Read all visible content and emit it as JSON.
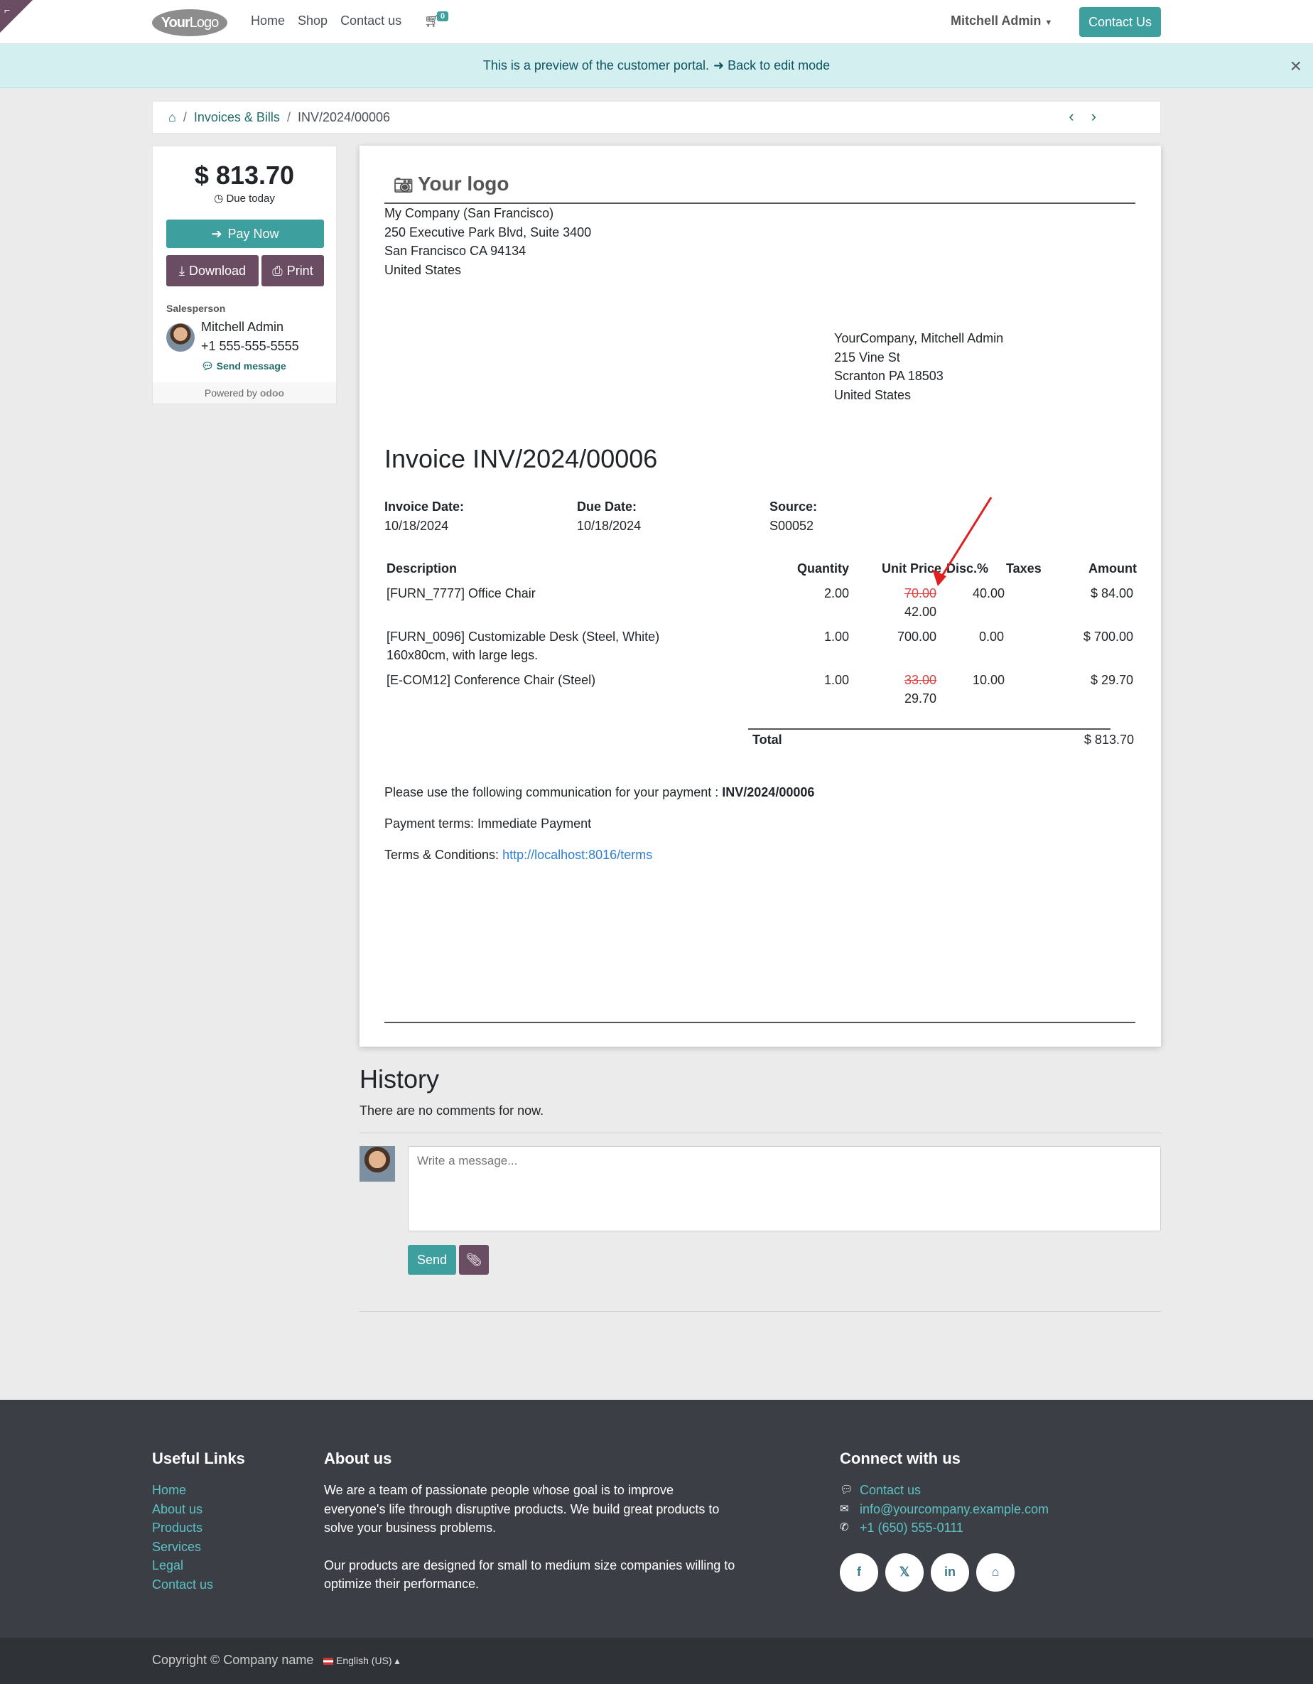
{
  "header": {
    "logo_your": "Your",
    "logo_logo": "Logo",
    "nav": [
      "Home",
      "Shop",
      "Contact us"
    ],
    "cart_count": "0",
    "user": "Mitchell Admin",
    "contact_btn": "Contact Us"
  },
  "preview": {
    "text": "This is a preview of the customer portal.",
    "back": "Back to edit mode"
  },
  "breadcrumb": {
    "section": "Invoices & Bills",
    "current": "INV/2024/00006"
  },
  "sidebar": {
    "amount": "$ 813.70",
    "due": "Due today",
    "pay": "Pay Now",
    "download": "Download",
    "print": "Print",
    "salesperson_label": "Salesperson",
    "salesperson_name": "Mitchell Admin",
    "salesperson_phone": "+1 555-555-5555",
    "send_message": "Send message",
    "powered": "Powered by",
    "powered_brand": "odoo"
  },
  "invoice": {
    "logo_text": "Your logo",
    "company": [
      "My Company (San Francisco)",
      "250 Executive Park Blvd, Suite 3400",
      "San Francisco CA 94134",
      "United States"
    ],
    "customer": [
      "YourCompany, Mitchell Admin",
      "215 Vine St",
      "Scranton PA 18503",
      "United States"
    ],
    "title": "Invoice INV/2024/00006",
    "invoice_date_label": "Invoice Date:",
    "invoice_date": "10/18/2024",
    "due_date_label": "Due Date:",
    "due_date": "10/18/2024",
    "source_label": "Source:",
    "source": "S00052",
    "columns": [
      "Description",
      "Quantity",
      "Unit Price",
      "Disc.%",
      "Taxes",
      "Amount"
    ],
    "lines": [
      {
        "desc": "[FURN_7777] Office Chair",
        "desc2": "",
        "qty": "2.00",
        "orig_price": "70.00",
        "price": "42.00",
        "disc": "40.00",
        "amount": "$ 84.00"
      },
      {
        "desc": "[FURN_0096] Customizable Desk (Steel, White)",
        "desc2": "160x80cm, with large legs.",
        "qty": "1.00",
        "orig_price": "",
        "price": "700.00",
        "disc": "0.00",
        "amount": "$ 700.00"
      },
      {
        "desc": "[E-COM12] Conference Chair (Steel)",
        "desc2": "",
        "qty": "1.00",
        "orig_price": "33.00",
        "price": "29.70",
        "disc": "10.00",
        "amount": "$ 29.70"
      }
    ],
    "total_label": "Total",
    "total": "$ 813.70",
    "communication_text": "Please use the following communication for your payment :",
    "communication_ref": "INV/2024/00006",
    "payment_terms": "Payment terms: Immediate Payment",
    "terms_label": "Terms & Conditions:",
    "terms_url": "http://localhost:8016/terms"
  },
  "history": {
    "title": "History",
    "empty": "There are no comments for now.",
    "placeholder": "Write a message...",
    "send": "Send"
  },
  "footer": {
    "useful_title": "Useful Links",
    "useful_links": [
      "Home",
      "About us",
      "Products",
      "Services",
      "Legal",
      "Contact us"
    ],
    "about_title": "About us",
    "about_p1": "We are a team of passionate people whose goal is to improve everyone's life through disruptive products. We build great products to solve your business problems.",
    "about_p2": "Our products are designed for small to medium size companies willing to optimize their performance.",
    "connect_title": "Connect with us",
    "contact_link": "Contact us",
    "email": "info@yourcompany.example.com",
    "phone": "+1 (650) 555-0111",
    "socials": [
      "f",
      "𝕏",
      "in",
      "⌂"
    ],
    "copyright": "Copyright © Company name",
    "language": "English (US)"
  },
  "colors": {
    "primary": "#3d9f9e",
    "secondary": "#6b4d63",
    "footer_bg": "#3b3f45",
    "strike": "#e04040"
  }
}
